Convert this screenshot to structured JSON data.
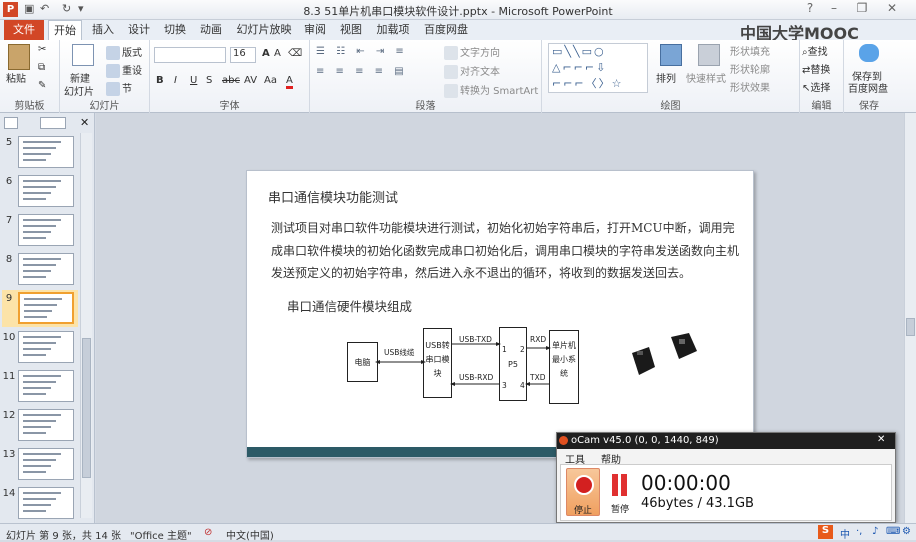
{
  "window": {
    "title": "8.3 51单片机串口模块软件设计.pptx - Microsoft PowerPoint"
  },
  "watermark": "中国大学MOOC",
  "tabs": [
    "文件",
    "开始",
    "插入",
    "设计",
    "切换",
    "动画",
    "幻灯片放映",
    "审阅",
    "视图",
    "加载项",
    "百度网盘"
  ],
  "ribbon": {
    "clipboard": {
      "paste": "粘贴",
      "label": "剪贴板"
    },
    "slides": {
      "new_slide_1": "新建",
      "new_slide_2": "幻灯片",
      "layout": "版式",
      "reset": "重设",
      "section": "节",
      "label": "幻灯片"
    },
    "font": {
      "size": "16",
      "bold": "B",
      "italic": "I",
      "underline": "U",
      "shadow": "S",
      "strike": "abc",
      "spacing": "AV",
      "case": "Aa",
      "color": "A",
      "label": "字体"
    },
    "paragraph": {
      "text_direction": "文字方向",
      "align_text": "对齐文本",
      "smartart": "转换为 SmartArt",
      "label": "段落"
    },
    "drawing": {
      "arrange": "排列",
      "quick_styles": "快速样式",
      "fill": "形状填充",
      "outline": "形状轮廓",
      "effects": "形状效果",
      "label": "绘图"
    },
    "editing": {
      "find": "查找",
      "replace": "替换",
      "select": "选择",
      "label": "编辑"
    },
    "save": {
      "line1": "保存到",
      "line2": "百度网盘",
      "label": "保存"
    }
  },
  "slide_thumbs": [
    "5",
    "6",
    "7",
    "8",
    "9",
    "10",
    "11",
    "12",
    "13",
    "14"
  ],
  "selected_slide": "9",
  "slide": {
    "title": "串口通信模块功能测试",
    "body": "测试项目对串口软件功能模块进行测试，初始化初始字符串后，打开MCU中断，调用完成串口软件模块的初始化函数完成串口初始化后，调用串口模块的字符串发送函数向主机发送预定义的初始字符串，然后进入永不退出的循环，将收到的数据发送回去。",
    "subtitle": "串口通信硬件模块组成",
    "diagram": {
      "pc": "电脑",
      "usb_cable": "USB线缆",
      "converter": "USB转串口模块",
      "txd_label": "USB-TXD",
      "rxd_label": "USB-RXD",
      "p5": "P5",
      "pin1": "1",
      "pin2": "2",
      "pin3": "3",
      "pin4": "4",
      "rxd": "RXD",
      "txd": "TXD",
      "mcu": "单片机最小系统"
    }
  },
  "ocam": {
    "title": "oCam v45.0 (0, 0, 1440, 849)",
    "menu_tools": "工具",
    "menu_help": "帮助",
    "record": "停止",
    "pause": "暂停",
    "timer": "00:00:00",
    "size": "46bytes / 43.1GB"
  },
  "status": {
    "slide_info": "幻灯片 第 9 张，共 14 张",
    "theme": "\"Office 主题\"",
    "lang": "中文(中国)"
  },
  "tray": {
    "ime": "中"
  }
}
